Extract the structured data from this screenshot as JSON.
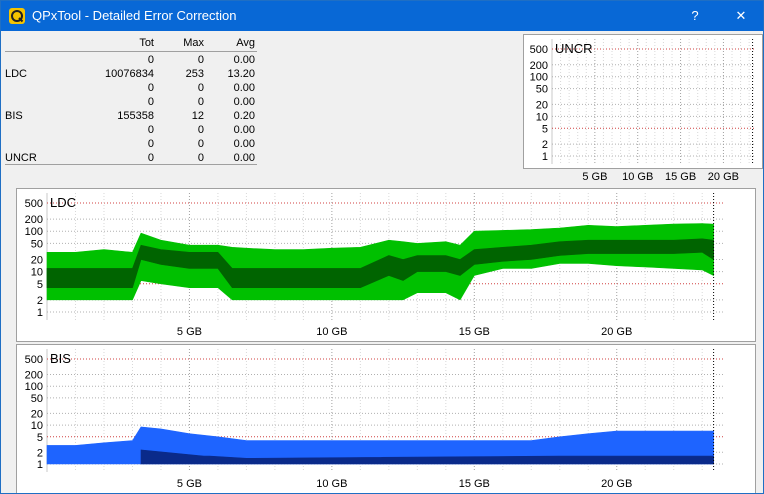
{
  "window": {
    "title": "QPxTool - Detailed Error Correction",
    "help_glyph": "?",
    "close_glyph": "✕"
  },
  "stats": {
    "headers": {
      "label": "",
      "tot": "Tot",
      "max": "Max",
      "avg": "Avg"
    },
    "rows": [
      {
        "label": "",
        "tot": "0",
        "max": "0",
        "avg": "0.00"
      },
      {
        "label": "LDC",
        "tot": "10076834",
        "max": "253",
        "avg": "13.20"
      },
      {
        "label": "",
        "tot": "0",
        "max": "0",
        "avg": "0.00"
      },
      {
        "label": "",
        "tot": "0",
        "max": "0",
        "avg": "0.00"
      },
      {
        "label": "BIS",
        "tot": "155358",
        "max": "12",
        "avg": "0.20"
      },
      {
        "label": "",
        "tot": "0",
        "max": "0",
        "avg": "0.00"
      },
      {
        "label": "",
        "tot": "0",
        "max": "0",
        "avg": "0.00"
      },
      {
        "label": "UNCR",
        "tot": "0",
        "max": "0",
        "avg": "0.00"
      }
    ]
  },
  "chart_data": [
    {
      "id": "uncr",
      "type": "area",
      "title": "UNCR",
      "y_scale": "log",
      "ylim": [
        1,
        500
      ],
      "ytick_labels": [
        "500",
        "200",
        "100",
        "50",
        "20",
        "10",
        "5",
        "2",
        "1"
      ],
      "ytick_values": [
        500,
        200,
        100,
        50,
        20,
        10,
        5,
        2,
        1
      ],
      "xlim": [
        0,
        23.8
      ],
      "xtick_labels": [
        "5 GB",
        "10 GB",
        "15 GB",
        "20 GB"
      ],
      "xtick_values": [
        5,
        10,
        15,
        20
      ],
      "end_marker_gb": 23.4,
      "series": []
    },
    {
      "id": "ldc",
      "type": "area",
      "title": "LDC",
      "y_scale": "log",
      "ylim": [
        1,
        500
      ],
      "ytick_labels": [
        "500",
        "200",
        "100",
        "50",
        "20",
        "10",
        "5",
        "2",
        "1"
      ],
      "ytick_values": [
        500,
        200,
        100,
        50,
        20,
        10,
        5,
        2,
        1
      ],
      "xlim": [
        0,
        23.8
      ],
      "xtick_labels": [
        "5 GB",
        "10 GB",
        "15 GB",
        "20 GB"
      ],
      "xtick_values": [
        5,
        10,
        15,
        20
      ],
      "end_marker_gb": 23.4,
      "series": [
        {
          "color": "#00c000",
          "x": [
            0,
            1,
            2,
            3,
            3.3,
            4,
            5,
            6,
            6.5,
            7,
            8,
            9,
            10,
            11,
            12,
            12.5,
            13,
            14,
            14.5,
            15,
            16,
            17,
            18,
            19,
            20,
            21,
            22,
            23,
            23.4
          ],
          "high": [
            30,
            30,
            35,
            30,
            90,
            60,
            45,
            45,
            40,
            38,
            35,
            35,
            38,
            40,
            60,
            55,
            50,
            55,
            45,
            100,
            105,
            110,
            120,
            140,
            130,
            140,
            150,
            155,
            150
          ],
          "low": [
            2,
            2,
            2,
            2,
            6,
            5,
            4,
            4,
            2,
            2,
            2,
            2,
            2,
            2,
            2,
            2,
            3,
            3,
            2,
            8,
            12,
            12,
            16,
            16,
            14,
            13,
            12,
            11,
            8
          ]
        },
        {
          "color": "#006400",
          "x": [
            0,
            1,
            2,
            3,
            3.3,
            4,
            5,
            6,
            6.5,
            7,
            8,
            9,
            10,
            11,
            12,
            12.5,
            13,
            14,
            14.5,
            15,
            16,
            17,
            18,
            19,
            20,
            21,
            22,
            23,
            23.4
          ],
          "high": [
            12,
            12,
            12,
            12,
            45,
            35,
            30,
            30,
            12,
            12,
            12,
            12,
            12,
            12,
            25,
            20,
            25,
            25,
            20,
            35,
            40,
            45,
            55,
            60,
            60,
            60,
            60,
            65,
            60
          ],
          "low": [
            4,
            4,
            4,
            4,
            20,
            15,
            12,
            12,
            4,
            4,
            4,
            4,
            4,
            4,
            8,
            6,
            10,
            10,
            8,
            15,
            18,
            20,
            25,
            28,
            28,
            28,
            28,
            30,
            20
          ]
        }
      ]
    },
    {
      "id": "bis",
      "type": "area",
      "title": "BIS",
      "y_scale": "log",
      "ylim": [
        1,
        500
      ],
      "ytick_labels": [
        "500",
        "200",
        "100",
        "50",
        "20",
        "10",
        "5",
        "2",
        "1"
      ],
      "ytick_values": [
        500,
        200,
        100,
        50,
        20,
        10,
        5,
        2,
        1
      ],
      "xlim": [
        0,
        23.8
      ],
      "xtick_labels": [
        "5 GB",
        "10 GB",
        "15 GB",
        "20 GB"
      ],
      "xtick_values": [
        5,
        10,
        15,
        20
      ],
      "end_marker_gb": 23.4,
      "series": [
        {
          "color": "#1e64ff",
          "x": [
            0,
            1,
            2,
            3,
            3.3,
            4,
            5,
            6,
            7,
            8,
            9,
            10,
            11,
            12,
            13,
            14,
            15,
            16,
            17,
            18,
            19,
            20,
            21,
            22,
            23,
            23.4
          ],
          "high": [
            3,
            3,
            3.5,
            4,
            9,
            8,
            6,
            5,
            4,
            4,
            4,
            4,
            4,
            4,
            4,
            4,
            4,
            4,
            4,
            5,
            6,
            7,
            7,
            7,
            7,
            7
          ],
          "low": [
            1,
            1,
            1,
            1,
            1,
            1,
            1,
            1,
            1,
            1,
            1,
            1,
            1,
            1,
            1,
            1,
            1,
            1,
            1,
            1,
            1,
            1,
            1,
            1,
            1,
            1
          ]
        },
        {
          "color": "#0a2a8a",
          "x": [
            3.3,
            5.5,
            5.7,
            7.0,
            18.0,
            23.4
          ],
          "high": [
            2.3,
            1.6,
            1.6,
            1.4,
            1.6,
            1.6
          ],
          "low": [
            1,
            1,
            1,
            1,
            1,
            1
          ]
        }
      ]
    }
  ]
}
